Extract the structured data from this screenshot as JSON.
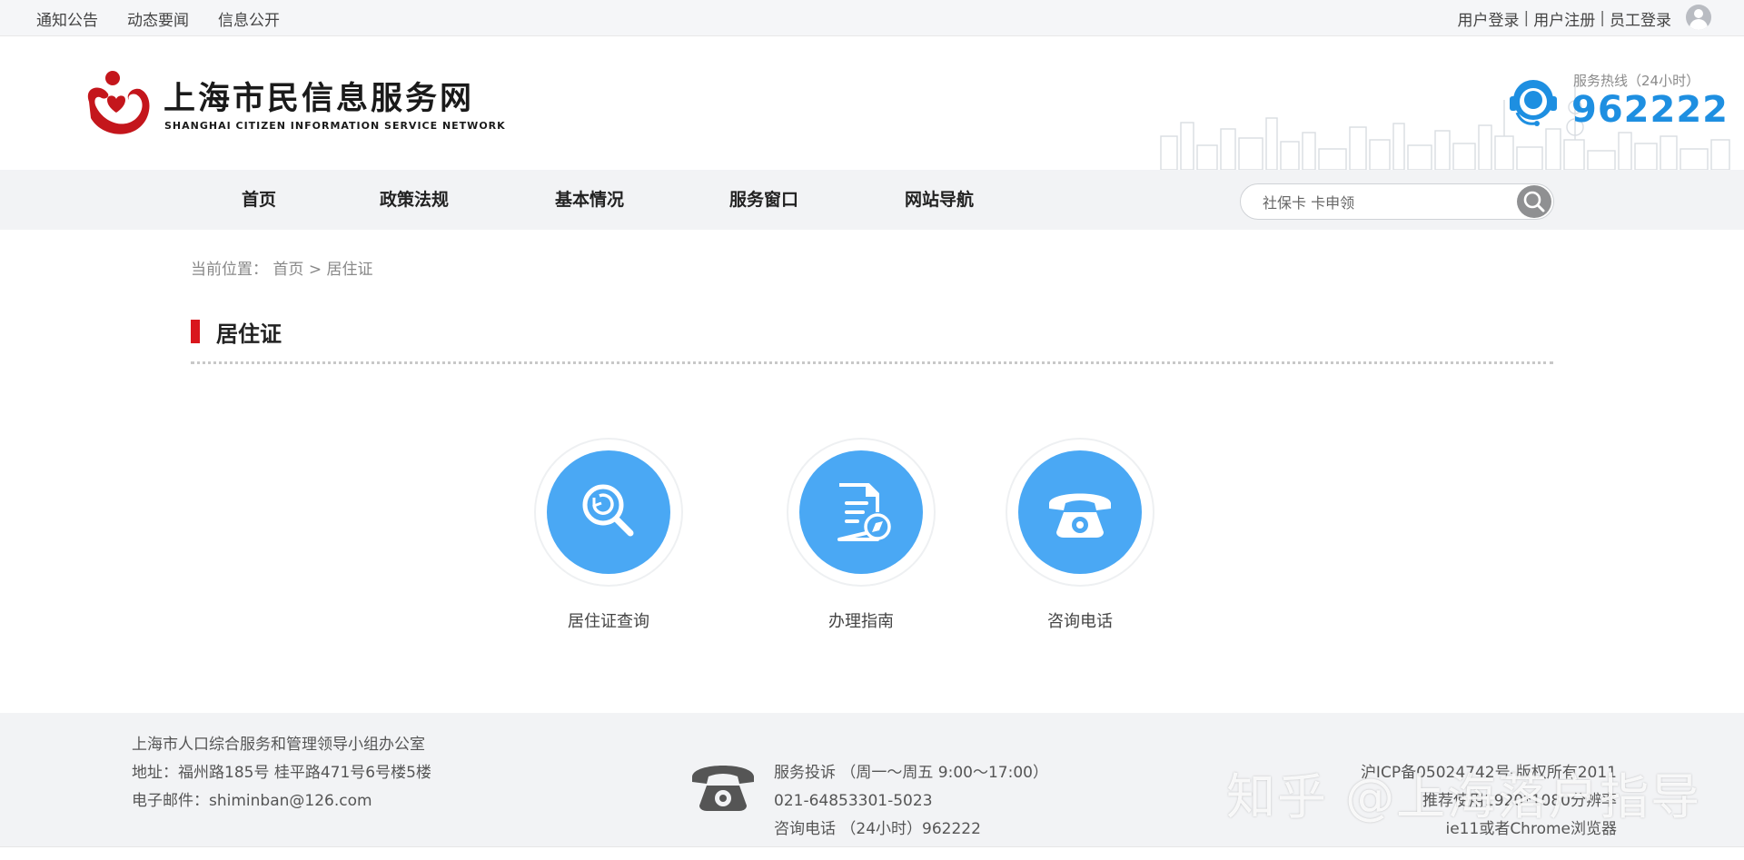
{
  "topbar": {
    "links": [
      "通知公告",
      "动态要闻",
      "信息公开"
    ],
    "auth": {
      "login": "用户登录",
      "register": "用户注册",
      "staff": "员工登录",
      "sep": "|"
    }
  },
  "header": {
    "logo_cn": "上海市民信息服务网",
    "logo_en": "SHANGHAI CITIZEN INFORMATION SERVICE NETWORK",
    "hotline_label": "服务热线（24小时）",
    "hotline_number": "962222"
  },
  "nav": {
    "items": [
      "首页",
      "政策法规",
      "基本情况",
      "服务窗口",
      "网站导航"
    ],
    "search_value": "社保卡 卡申领"
  },
  "breadcrumb": {
    "prefix": "当前位置：",
    "home": "首页",
    "sep": ">",
    "current": "居住证"
  },
  "page": {
    "title": "居住证"
  },
  "tiles": [
    {
      "label": "居住证查询",
      "icon": "search-icon"
    },
    {
      "label": "办理指南",
      "icon": "document-icon"
    },
    {
      "label": "咨询电话",
      "icon": "telephone-icon"
    }
  ],
  "footer": {
    "org": "上海市人口综合服务和管理领导小组办公室",
    "address": "地址：福州路185号    桂平路471号6号楼5楼",
    "email": "电子邮件：shiminban@126.com",
    "complaint": "服务投诉 （周一～周五 9:00～17:00）",
    "complaint_phone": "021-64853301-5023",
    "consult": "咨询电话 （24小时）962222",
    "icp": "沪ICP备05024742号-版权所有2011",
    "resolution": "推荐使用1920*1080分辨率",
    "browser": "ie11或者Chrome浏览器",
    "watermark": "知乎 @上海落户指导"
  },
  "colors": {
    "accent_red": "#d9161d",
    "tile_blue": "#4aa8f4",
    "hotline_blue": "#1e8fe1"
  }
}
